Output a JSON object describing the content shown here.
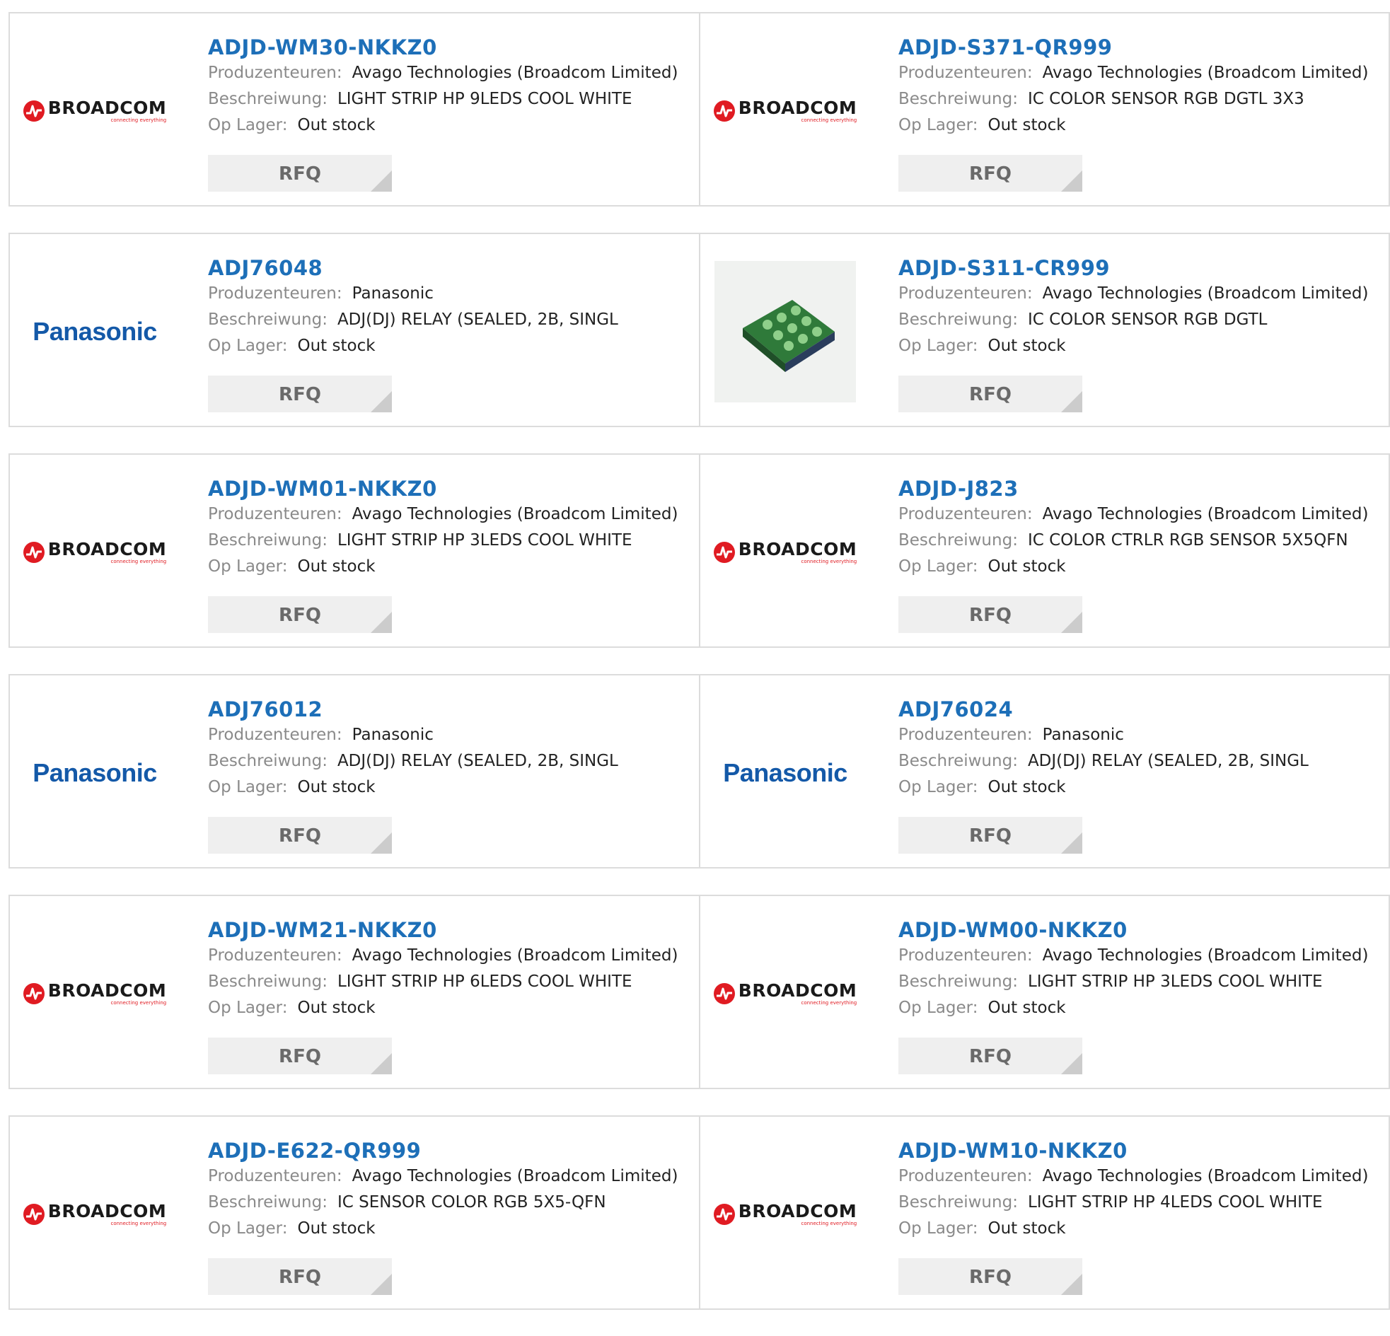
{
  "labels": {
    "manufacturer": "Produzenteuren:",
    "description": "Beschreiwung:",
    "stock": "Op Lager:",
    "rfq": "RFQ"
  },
  "brand": {
    "broadcom": "BROADCOM",
    "broadcom_tagline": "connecting everything",
    "panasonic": "Panasonic"
  },
  "colors": {
    "part_link": "#1d6fb8",
    "broadcom_red": "#e01b22",
    "panasonic_blue": "#1459a8"
  },
  "products": [
    {
      "part": "ADJD-WM30-NKKZ0",
      "manufacturer": "Avago Technologies (Broadcom Limited)",
      "description": "LIGHT STRIP HP 9LEDS COOL WHITE",
      "stock": "Out stock",
      "logo": "broadcom"
    },
    {
      "part": "ADJD-S371-QR999",
      "manufacturer": "Avago Technologies (Broadcom Limited)",
      "description": "IC COLOR SENSOR RGB DGTL 3X3",
      "stock": "Out stock",
      "logo": "broadcom"
    },
    {
      "part": "ADJ76048",
      "manufacturer": "Panasonic",
      "description": "ADJ(DJ) RELAY (SEALED, 2B, SINGL",
      "stock": "Out stock",
      "logo": "panasonic"
    },
    {
      "part": "ADJD-S311-CR999",
      "manufacturer": "Avago Technologies (Broadcom Limited)",
      "description": "IC COLOR SENSOR RGB DGTL",
      "stock": "Out stock",
      "logo": "chip-photo"
    },
    {
      "part": "ADJD-WM01-NKKZ0",
      "manufacturer": "Avago Technologies (Broadcom Limited)",
      "description": "LIGHT STRIP HP 3LEDS COOL WHITE",
      "stock": "Out stock",
      "logo": "broadcom"
    },
    {
      "part": "ADJD-J823",
      "manufacturer": "Avago Technologies (Broadcom Limited)",
      "description": "IC COLOR CTRLR RGB SENSOR 5X5QFN",
      "stock": "Out stock",
      "logo": "broadcom"
    },
    {
      "part": "ADJ76012",
      "manufacturer": "Panasonic",
      "description": "ADJ(DJ) RELAY (SEALED, 2B, SINGL",
      "stock": "Out stock",
      "logo": "panasonic"
    },
    {
      "part": "ADJ76024",
      "manufacturer": "Panasonic",
      "description": "ADJ(DJ) RELAY (SEALED, 2B, SINGL",
      "stock": "Out stock",
      "logo": "panasonic"
    },
    {
      "part": "ADJD-WM21-NKKZ0",
      "manufacturer": "Avago Technologies (Broadcom Limited)",
      "description": "LIGHT STRIP HP 6LEDS COOL WHITE",
      "stock": "Out stock",
      "logo": "broadcom"
    },
    {
      "part": "ADJD-WM00-NKKZ0",
      "manufacturer": "Avago Technologies (Broadcom Limited)",
      "description": "LIGHT STRIP HP 3LEDS COOL WHITE",
      "stock": "Out stock",
      "logo": "broadcom"
    },
    {
      "part": "ADJD-E622-QR999",
      "manufacturer": "Avago Technologies (Broadcom Limited)",
      "description": "IC SENSOR COLOR RGB 5X5-QFN",
      "stock": "Out stock",
      "logo": "broadcom"
    },
    {
      "part": "ADJD-WM10-NKKZ0",
      "manufacturer": "Avago Technologies (Broadcom Limited)",
      "description": "LIGHT STRIP HP 4LEDS COOL WHITE",
      "stock": "Out stock",
      "logo": "broadcom"
    }
  ]
}
